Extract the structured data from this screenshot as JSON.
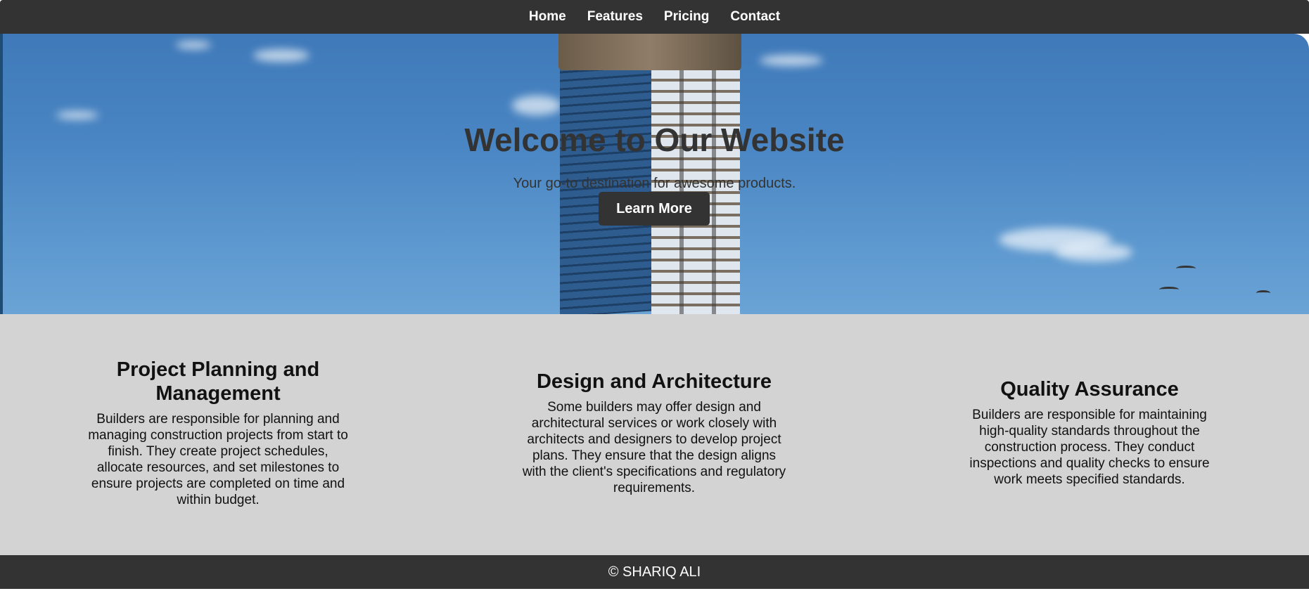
{
  "nav": {
    "items": [
      {
        "label": "Home"
      },
      {
        "label": "Features"
      },
      {
        "label": "Pricing"
      },
      {
        "label": "Contact"
      }
    ]
  },
  "hero": {
    "title": "Welcome to Our Website",
    "subtitle": "Your go-to destination for awesome products.",
    "button_label": "Learn More"
  },
  "features": [
    {
      "title": "Project Planning and Management",
      "text": "Builders are responsible for planning and managing construction projects from start to finish. They create project schedules, allocate resources, and set milestones to ensure projects are completed on time and within budget."
    },
    {
      "title": "Design and Architecture",
      "text": "Some builders may offer design and architectural services or work closely with architects and designers to develop project plans. They ensure that the design aligns with the client's specifications and regulatory requirements."
    },
    {
      "title": "Quality Assurance",
      "text": "Builders are responsible for maintaining high-quality standards throughout the construction process. They conduct inspections and quality checks to ensure work meets specified standards."
    }
  ],
  "footer": {
    "text": "© SHARIQ ALI"
  },
  "colors": {
    "nav_bg": "#333333",
    "features_bg": "#d3d3d3",
    "footer_bg": "#333333",
    "sky": "#4a86c3"
  }
}
